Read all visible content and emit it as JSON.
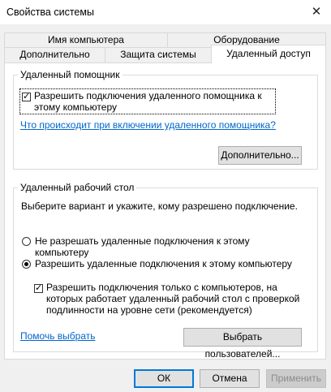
{
  "window": {
    "title": "Свойства системы"
  },
  "tabs": {
    "row1": [
      "Имя компьютера",
      "Оборудование"
    ],
    "row2": [
      "Дополнительно",
      "Защита системы",
      "Удаленный доступ"
    ]
  },
  "remote_assistance": {
    "legend": "Удаленный помощник",
    "checkbox_label": "Разрешить подключения удаленного помощника к этому компьютеру",
    "checkbox_checked": true,
    "help_link": "Что происходит при включении удаленного помощника?",
    "advanced_button": "Дополнительно..."
  },
  "remote_desktop": {
    "legend": "Удаленный рабочий стол",
    "instruction": "Выберите вариант и укажите, кому разрешено подключение.",
    "radio_deny": "Не разрешать удаленные подключения к этому компьютеру",
    "radio_allow": "Разрешить удаленные подключения к этому компьютеру",
    "selected": "allow",
    "nla_checkbox_label": "Разрешить подключения только с компьютеров, на которых работает удаленный рабочий стол с проверкой подлинности на уровне сети (рекомендуется)",
    "nla_checked": true,
    "help_link": "Помочь выбрать",
    "select_users_button": "Выбрать пользователей..."
  },
  "footer": {
    "ok": "ОК",
    "cancel": "Отмена",
    "apply": "Применить"
  },
  "icons": {
    "close": "close-icon",
    "check": "checkmark-icon"
  }
}
